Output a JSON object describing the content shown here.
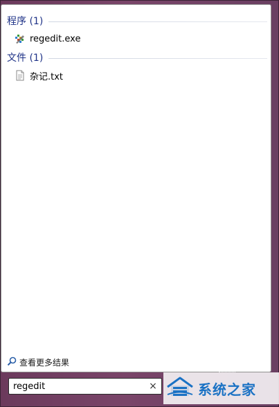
{
  "results": {
    "groups": [
      {
        "header": "程序 (1)",
        "items": [
          {
            "label": "regedit.exe",
            "icon": "regedit-icon"
          }
        ]
      },
      {
        "header": "文件 (1)",
        "items": [
          {
            "label": "杂记.txt",
            "icon": "text-file-icon"
          }
        ]
      }
    ],
    "see_more_label": "查看更多结果",
    "see_more_icon": "search-icon"
  },
  "search": {
    "value": "regedit",
    "clear_glyph": "×",
    "clear_icon": "close-icon"
  },
  "watermark": {
    "text": "系统之家",
    "icon": "house-logo"
  },
  "colors": {
    "header_text": "#1e3287",
    "background": "#6b3a5c",
    "watermark_text": "#1b72c4"
  }
}
